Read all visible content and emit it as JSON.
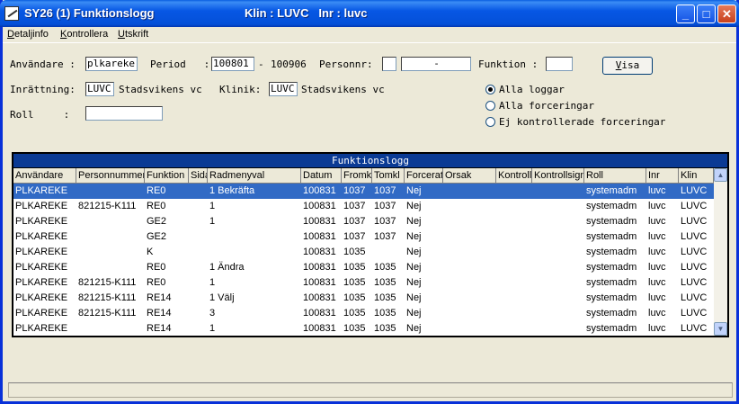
{
  "window": {
    "title": "SY26 (1) Funktionslogg",
    "title_info": "Klin : LUVC   Inr : luvc",
    "minimize": "_",
    "maximize": "□",
    "close": "✕"
  },
  "menu": [
    {
      "label_first": "D",
      "label_rest": "etaljinfo"
    },
    {
      "label_first": "K",
      "label_rest": "ontrollera"
    },
    {
      "label_first": "U",
      "label_rest": "tskrift"
    }
  ],
  "form": {
    "user_label": "Användare :",
    "user_value": "plkareke",
    "period_label": "Period   :",
    "period_from": "100801",
    "period_sep": "-",
    "period_to": "100906",
    "personnr_label": "Personnr:",
    "personnr_a": "",
    "personnr_b": "-",
    "funktion_label": "Funktion :",
    "funktion_value": "",
    "inrattning_label": "Inrättning:",
    "inrattning_code": "LUVC",
    "inrattning_name": "Stadsvikens vc",
    "klinik_label": "Klinik:",
    "klinik_code": "LUVC",
    "klinik_name": "Stadsvikens vc",
    "roll_label": "Roll     :",
    "roll_value": "",
    "visa_first": "V",
    "visa_rest": "isa"
  },
  "options": [
    {
      "label": "Alla loggar",
      "selected": true
    },
    {
      "label": "Alla forceringar",
      "selected": false
    },
    {
      "label": "Ej kontrollerade forceringar",
      "selected": false
    }
  ],
  "grid": {
    "title": "Funktionslogg",
    "columns": [
      "Användare",
      "Personnummer",
      "Funktion",
      "Sida",
      "Radmenyval",
      "Datum",
      "Fromkl",
      "Tomkl",
      "Forcerat",
      "Orsak",
      "Kontroll",
      "Kontrollsign",
      "Roll",
      "Inr",
      "Klin"
    ],
    "rows": [
      [
        "PLKAREKE",
        "",
        "RE0",
        "",
        "1 Bekräfta",
        "100831",
        "1037",
        "1037",
        "Nej",
        "",
        "",
        "",
        "systemadm",
        "luvc",
        "LUVC"
      ],
      [
        "PLKAREKE",
        "821215-K111",
        "RE0",
        "",
        "1",
        "100831",
        "1037",
        "1037",
        "Nej",
        "",
        "",
        "",
        "systemadm",
        "luvc",
        "LUVC"
      ],
      [
        "PLKAREKE",
        "",
        "GE2",
        "",
        "1",
        "100831",
        "1037",
        "1037",
        "Nej",
        "",
        "",
        "",
        "systemadm",
        "luvc",
        "LUVC"
      ],
      [
        "PLKAREKE",
        "",
        "GE2",
        "",
        "",
        "100831",
        "1037",
        "1037",
        "Nej",
        "",
        "",
        "",
        "systemadm",
        "luvc",
        "LUVC"
      ],
      [
        "PLKAREKE",
        "",
        "K",
        "",
        "",
        "100831",
        "1035",
        "",
        "Nej",
        "",
        "",
        "",
        "systemadm",
        "luvc",
        "LUVC"
      ],
      [
        "PLKAREKE",
        "",
        "RE0",
        "",
        "1 Ändra",
        "100831",
        "1035",
        "1035",
        "Nej",
        "",
        "",
        "",
        "systemadm",
        "luvc",
        "LUVC"
      ],
      [
        "PLKAREKE",
        "821215-K111",
        "RE0",
        "",
        "1",
        "100831",
        "1035",
        "1035",
        "Nej",
        "",
        "",
        "",
        "systemadm",
        "luvc",
        "LUVC"
      ],
      [
        "PLKAREKE",
        "821215-K111",
        "RE14",
        "",
        "1 Välj",
        "100831",
        "1035",
        "1035",
        "Nej",
        "",
        "",
        "",
        "systemadm",
        "luvc",
        "LUVC"
      ],
      [
        "PLKAREKE",
        "821215-K111",
        "RE14",
        "",
        "3",
        "100831",
        "1035",
        "1035",
        "Nej",
        "",
        "",
        "",
        "systemadm",
        "luvc",
        "LUVC"
      ],
      [
        "PLKAREKE",
        "",
        "RE14",
        "",
        "1",
        "100831",
        "1035",
        "1035",
        "Nej",
        "",
        "",
        "",
        "systemadm",
        "luvc",
        "LUVC"
      ]
    ],
    "selected_row": 0,
    "scroll_up": "▲",
    "scroll_down": "▼"
  },
  "colors": {
    "titlebar": "#0450d8",
    "selection": "#316ac5",
    "grid_title": "#0a3a94",
    "window_bg": "#ece9d8"
  }
}
